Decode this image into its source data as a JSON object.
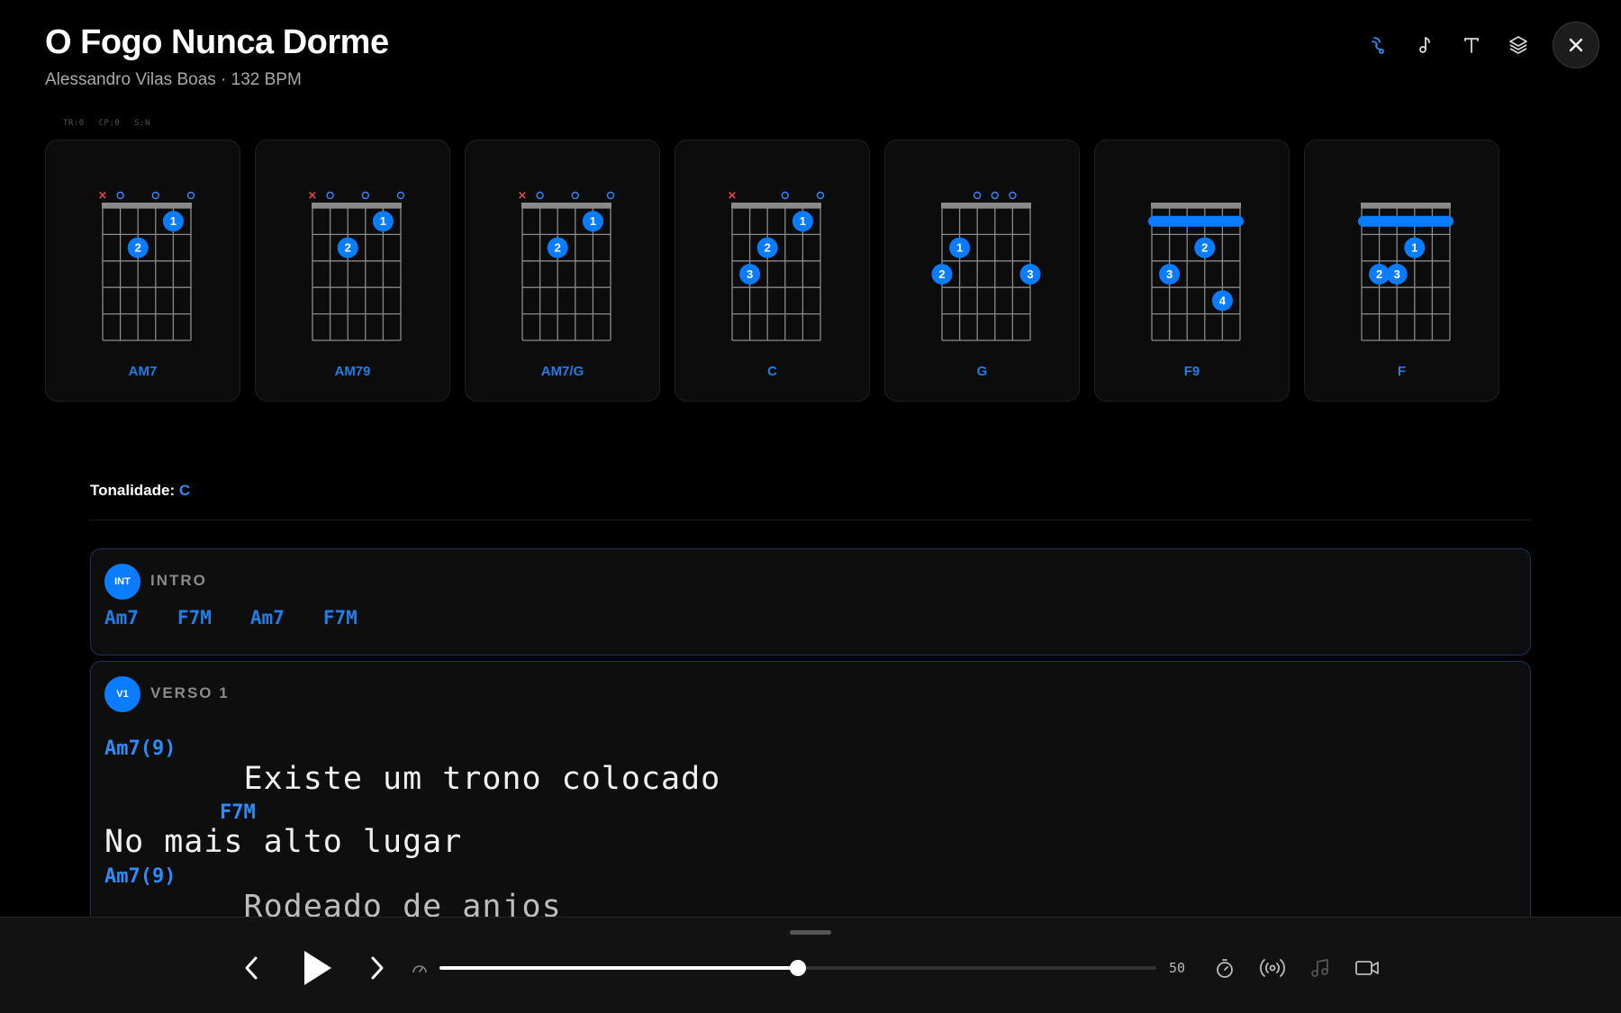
{
  "song": {
    "title": "O Fogo Nunca Dorme",
    "subtitle": "Alessandro Vilas Boas · 132 BPM"
  },
  "toolbar": {
    "icons": [
      "chord-diagram-icon",
      "music-note-icon",
      "text-icon",
      "layers-icon"
    ],
    "close": "close-icon",
    "accent": "#2f8bf5"
  },
  "debug_text": "TR:0 CP:0 S:N",
  "chords": [
    {
      "name": "AM7",
      "muted": [
        0
      ],
      "open": [
        1,
        3,
        5
      ],
      "barre": false,
      "dots": [
        {
          "string": 4,
          "fret": 1,
          "finger": "1"
        },
        {
          "string": 2,
          "fret": 2,
          "finger": "2"
        }
      ]
    },
    {
      "name": "AM79",
      "muted": [
        0
      ],
      "open": [
        1,
        3,
        5
      ],
      "barre": false,
      "dots": [
        {
          "string": 4,
          "fret": 1,
          "finger": "1"
        },
        {
          "string": 2,
          "fret": 2,
          "finger": "2"
        }
      ]
    },
    {
      "name": "AM7/G",
      "muted": [
        0
      ],
      "open": [
        1,
        3,
        5
      ],
      "barre": false,
      "dots": [
        {
          "string": 4,
          "fret": 1,
          "finger": "1"
        },
        {
          "string": 2,
          "fret": 2,
          "finger": "2"
        }
      ]
    },
    {
      "name": "C",
      "muted": [
        0
      ],
      "open": [
        3,
        5
      ],
      "barre": false,
      "dots": [
        {
          "string": 4,
          "fret": 1,
          "finger": "1"
        },
        {
          "string": 2,
          "fret": 2,
          "finger": "2"
        },
        {
          "string": 1,
          "fret": 3,
          "finger": "3"
        }
      ]
    },
    {
      "name": "G",
      "muted": [],
      "open": [
        2,
        3,
        4
      ],
      "barre": false,
      "dots": [
        {
          "string": 1,
          "fret": 2,
          "finger": "1"
        },
        {
          "string": 0,
          "fret": 3,
          "finger": "2"
        },
        {
          "string": 5,
          "fret": 3,
          "finger": "3"
        }
      ]
    },
    {
      "name": "F9",
      "muted": [],
      "open": [],
      "barre": true,
      "dots": [
        {
          "string": 3,
          "fret": 2,
          "finger": "2"
        },
        {
          "string": 1,
          "fret": 3,
          "finger": "3"
        },
        {
          "string": 4,
          "fret": 4,
          "finger": "4"
        }
      ]
    },
    {
      "name": "F",
      "muted": [],
      "open": [],
      "barre": true,
      "dots": [
        {
          "string": 3,
          "fret": 2,
          "finger": "1"
        },
        {
          "string": 1,
          "fret": 3,
          "finger": "2"
        },
        {
          "string": 2,
          "fret": 3,
          "finger": "3"
        }
      ]
    }
  ],
  "key": {
    "label": "Tonalidade:",
    "value": "C"
  },
  "sections": {
    "intro": {
      "badge": "INT",
      "label": "INTRO",
      "chords": [
        "Am7",
        "F7M",
        "Am7",
        "F7M"
      ]
    },
    "verse1": {
      "badge": "V1",
      "label": "VERSO 1",
      "lines": [
        {
          "chord": "Am7(9)",
          "lyric": "       Existe um trono colocado"
        },
        {
          "chord": "  F7M",
          "lyric": "No mais alto lugar"
        },
        {
          "chord": "Am7(9)",
          "lyric": "       Rodeado de anjos"
        }
      ]
    }
  },
  "player": {
    "prev": "chevron-left-icon",
    "play": "play-icon",
    "next": "chevron-right-icon",
    "speed_icon": "speedometer-icon",
    "speed_value": "50",
    "progress": 0.5,
    "right_icons": [
      "timer-icon",
      "broadcast-icon",
      "music-notes-icon",
      "video-camera-icon"
    ]
  }
}
